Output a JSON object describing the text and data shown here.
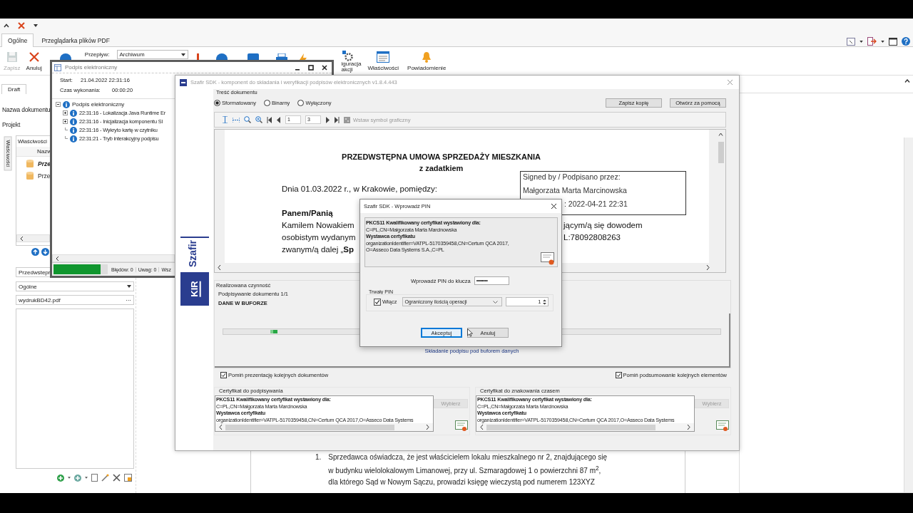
{
  "tabs": [
    {
      "label": "Ogólne",
      "selected": true
    },
    {
      "label": "Przeglądarka plików PDF",
      "selected": false
    }
  ],
  "ribbon": {
    "buttons": [
      {
        "label": "Zapisz",
        "disabled": true
      },
      {
        "label": "Anuluj",
        "disabled": false
      }
    ],
    "flow_label": "Przepływ:",
    "flow_value": "Archiwum",
    "cut_labels": [
      "iguracja",
      "akcji"
    ],
    "right_buttons": [
      "Właściwości",
      "Powiadomienie"
    ]
  },
  "left_panel": {
    "tab": "Draft",
    "fields": [
      "Nazwa dokumentu",
      "Projekt"
    ],
    "side_tab": "Właściwości",
    "properties_title": "Właściwości",
    "column": "Nazw",
    "rows": [
      {
        "label": "Prze",
        "bold": true
      },
      {
        "label": "Prze",
        "bold": false
      }
    ],
    "name_field": "Przedwstepr",
    "category": "Ogólne",
    "file": "wydrukBD42.pdf",
    "file_button": "···"
  },
  "log_window": {
    "title": "Podpis elektroniczny",
    "start_label": "Start:",
    "start": "21.04.2022 22:31:16",
    "duration_label": "Czas wykonania:",
    "duration": "00:00:20",
    "tree": {
      "label": "Podpis elektroniczny",
      "expanded": true,
      "children": [
        {
          "label": "22:31:16 - Lokalizacja Java Runtime Er",
          "expandable": true
        },
        {
          "label": "22:31:16 - Inicjalizacja komponentu Sl",
          "expandable": true
        },
        {
          "label": "22:31:16 - Wykryto kartę w czytniku",
          "expandable": false
        },
        {
          "label": "22:31:21 - Tryb interakcyjny podpisu",
          "expandable": false
        }
      ]
    },
    "progress": {
      "level": 0.87
    },
    "status": [
      "Błędów: 0",
      "Uwag: 0",
      "Wsz"
    ]
  },
  "sdk_window": {
    "title": "Szafir SDK - komponent do składania i weryfikacji podpisów elektronicznych v1.8.4.443",
    "logo": {
      "brand": "Szafir",
      "mark": "KIR"
    },
    "content_group": "Treść dokumentu",
    "modes": [
      {
        "label": "Sformatowany",
        "selected": true
      },
      {
        "label": "Binarny",
        "selected": false
      },
      {
        "label": "Wyłączony",
        "selected": false
      }
    ],
    "actions": [
      "Zapisz kopię",
      "Otwórz za pomocą"
    ],
    "page_field": "1",
    "page_count": "3",
    "insert_symbol": {
      "label": "Wstaw symbol graficzny",
      "disabled": true
    },
    "document": {
      "title": "PRZEDWSTĘPNA UMOWA SPRZEDAŻY MIESZKANIA",
      "subtitle": "z zadatkiem",
      "rows": [
        {
          "kind": "plain",
          "left": "Dnia 01.03.2022 r., w Krakowie, pomiędzy:"
        },
        {
          "kind": "heading",
          "left": "Panem/Panią"
        },
        {
          "kind": "plain",
          "left": "Kamilem Nowakiem",
          "right": "jącym/ą się dowodem"
        },
        {
          "kind": "plain",
          "left": "osobistym wydanym",
          "right": "L:78092808263"
        },
        {
          "kind": "plain",
          "left": "zwanym/ą dalej „**Sp**"
        }
      ],
      "signature": [
        "Signed by / Podpisano przez:",
        "Małgorzata Marta Marcinowska",
        ": 2022-04-21 22:31"
      ]
    },
    "activity": {
      "title": "Realizowana czynność",
      "step": "Podpisywanie dokumentu 1/1",
      "state": "DANE W BUFORZE",
      "message": "Składanie podpisu pod buforem danych"
    },
    "options": [
      {
        "label": "Pomiń prezentację kolejnych dokumentów",
        "checked": true
      },
      {
        "label": "Pomiń podsumowanie kolejnych elementów",
        "checked": true
      }
    ],
    "certificates": [
      {
        "title": "Certyfikat do podpisywania",
        "button": "Wybierz",
        "lines": [
          {
            "kind": "heading",
            "text": "PKCS11 Kwalifikowany certyfikat wystawiony dla:"
          },
          {
            "kind": "plain",
            "text": "C=PL,CN=Małgorzata Marta Marcinowska"
          },
          {
            "kind": "heading",
            "text": "Wystawca certyfikatu"
          },
          {
            "kind": "plain",
            "text": "organizationIdentifier=VATPL-5170359458,CN=Certum QCA 2017,O=Asseco Data Systems"
          }
        ]
      },
      {
        "title": "Certyfikat do znakowania czasem",
        "button": "Wybierz",
        "lines": [
          {
            "kind": "heading",
            "text": "PKCS11 Kwalifikowany certyfikat wystawiony dla:"
          },
          {
            "kind": "plain",
            "text": "C=PL,CN=Małgorzata Marta Marcinowska"
          },
          {
            "kind": "heading",
            "text": "Wystawca certyfikatu"
          },
          {
            "kind": "plain",
            "text": "organizationIdentifier=VATPL-5170359458,CN=Certum QCA 2017,O=Asseco Data Systems"
          }
        ]
      }
    ]
  },
  "pin_dialog": {
    "title": "Szafir SDK - Wprowadź PIN",
    "certificate": [
      {
        "kind": "heading",
        "text": "PKCS11 Kwalifikowany certyfikat wystawiony dla:"
      },
      {
        "kind": "plain",
        "text": "C=PL,CN=Małgorzata Marta Marcinowska"
      },
      {
        "kind": "heading",
        "text": "Wystawca certyfikatu"
      },
      {
        "kind": "plain",
        "text": "organizationIdentifier=VATPL-5170359458,CN=Certum QCA 2017,"
      },
      {
        "kind": "plain",
        "text": "O=Asseco Data Systems S.A.,C=PL"
      }
    ],
    "pin_label": "Wprowadź PIN do klucza",
    "pin_value": "••••••••",
    "persistent": {
      "title": "Trwały PIN",
      "enable_label": "Włącz",
      "checked": true,
      "mode": "Ograniczony ilością operacji",
      "count": "1"
    },
    "buttons": [
      {
        "label": "Akceptuj",
        "default": true
      },
      {
        "label": "Anuluj",
        "default": false
      }
    ]
  },
  "background_document": {
    "number": "1.",
    "lines": [
      "Sprzedawca oświadcza, że jest właścicielem lokalu mieszkalnego nr 2, znajdującego się",
      "w budynku wielolokalowym Limanowej, przy ul. Szmaragdowej 1 o powierzchni 87 m$^{2}$,",
      "dla którego Sąd w Nowym Sączu, prowadzi księgę wieczystą pod numerem 123XYZ"
    ]
  }
}
